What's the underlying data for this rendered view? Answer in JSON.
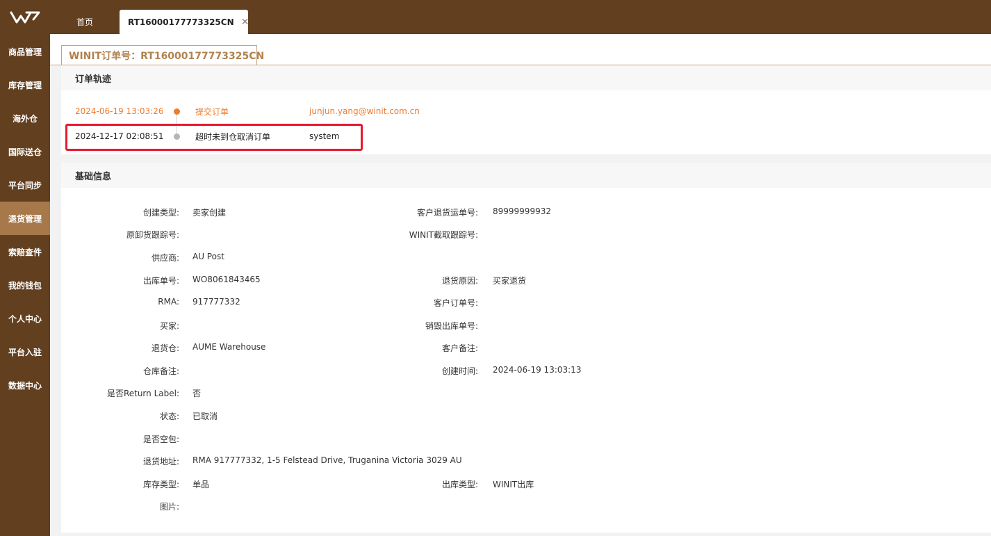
{
  "brand": {
    "logo_icon": "winit-logo-icon"
  },
  "sidebar": {
    "items": [
      {
        "label": "商品管理",
        "active": false
      },
      {
        "label": "库存管理",
        "active": false
      },
      {
        "label": "海外仓",
        "active": false
      },
      {
        "label": "国际送仓",
        "active": false
      },
      {
        "label": "平台同步",
        "active": false
      },
      {
        "label": "退货管理",
        "active": true
      },
      {
        "label": "索赔查件",
        "active": false
      },
      {
        "label": "我的钱包",
        "active": false
      },
      {
        "label": "个人中心",
        "active": false
      },
      {
        "label": "平台入驻",
        "active": false
      },
      {
        "label": "数据中心",
        "active": false
      }
    ]
  },
  "tabs": {
    "home": "首页",
    "active": "RT16000177773325CN",
    "close_icon": "close-icon"
  },
  "subtab": {
    "title": "WINIT订单号：RT16000177773325CN"
  },
  "track": {
    "title": "订单轨迹",
    "rows": [
      {
        "time": "2024-06-19 13:03:26",
        "action": "提交订单",
        "user": "junjun.yang@winit.com.cn"
      },
      {
        "time": "2024-12-17 02:08:51",
        "action": "超时未到仓取消订单",
        "user": "system"
      }
    ]
  },
  "info": {
    "title": "基础信息",
    "create_type_label": "创建类型:",
    "create_type": "卖家创建",
    "customer_return_no_label": "客户退货运单号:",
    "customer_return_no": "89999999932",
    "orig_tracking_label": "原卸货跟踪号:",
    "orig_tracking": "",
    "winit_tracking_label": "WINIT截取跟踪号:",
    "winit_tracking": "",
    "supplier_label": "供应商:",
    "supplier": "AU Post",
    "outbound_no_label": "出库单号:",
    "outbound_no": "WO8061843465",
    "return_reason_label": "退货原因:",
    "return_reason": "买家退货",
    "rma_label": "RMA:",
    "rma": "917777332",
    "customer_order_label": "客户订单号:",
    "customer_order": "",
    "buyer_label": "买家:",
    "buyer": "",
    "destroy_no_label": "销毁出库单号:",
    "destroy_no": "",
    "return_wh_label": "退货仓:",
    "return_wh": "AUME Warehouse",
    "customer_note_label": "客户备注:",
    "customer_note": "",
    "wh_note_label": "仓库备注:",
    "wh_note": "",
    "create_time_label": "创建时间:",
    "create_time": "2024-06-19 13:03:13",
    "return_label_label": "是否Return Label:",
    "return_label": "否",
    "status_label": "状态:",
    "status": "已取消",
    "empty_pkg_label": "是否空包:",
    "empty_pkg": "",
    "return_addr_label": "退货地址:",
    "return_addr": "RMA 917777332, 1-5 Felstead Drive, Truganina Victoria 3029 AU",
    "stock_type_label": "库存类型:",
    "stock_type": "单品",
    "outbound_type_label": "出库类型:",
    "outbound_type": "WINIT出库",
    "images_label": "图片:",
    "images": ""
  },
  "colors": {
    "brand_brown": "#623f1f",
    "active_nav": "#a6784a",
    "accent_orange": "#f07a2a",
    "highlight_red": "#e8182e"
  }
}
